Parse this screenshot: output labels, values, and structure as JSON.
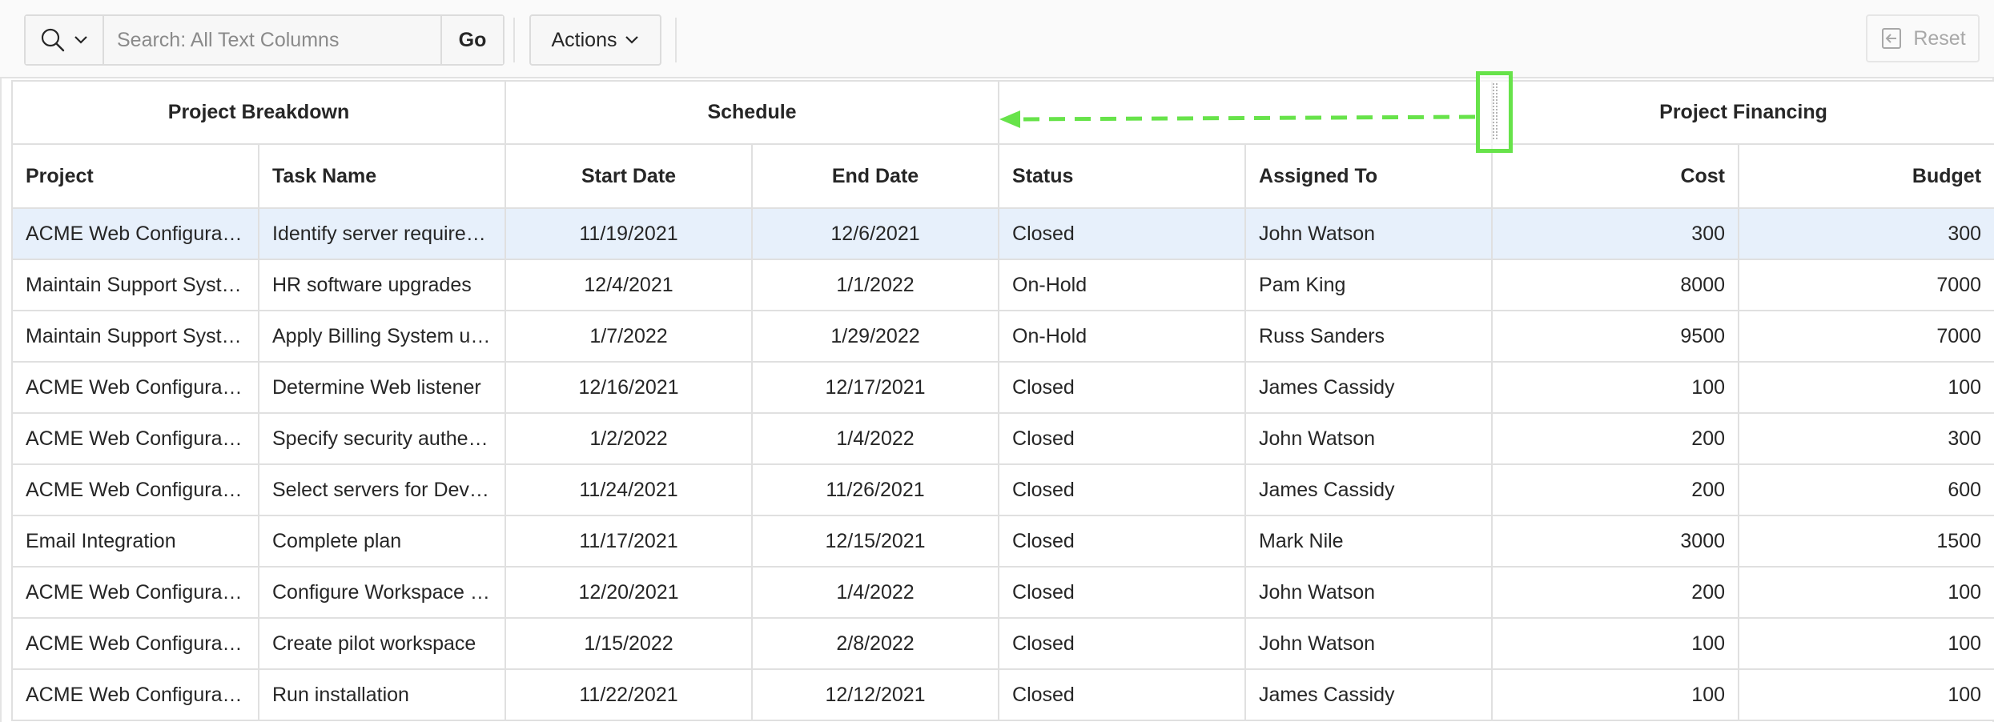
{
  "toolbar": {
    "search_placeholder": "Search: All Text Columns",
    "go_label": "Go",
    "actions_label": "Actions",
    "reset_label": "Reset"
  },
  "icons": {
    "search": "search-icon",
    "chevron": "chevron-down-icon",
    "reset": "reset-icon"
  },
  "colors": {
    "selected_row": "#e7f0fb",
    "drag_highlight": "#67e34a"
  },
  "groups": [
    {
      "label": "Project Breakdown"
    },
    {
      "label": "Schedule"
    },
    {
      "label": ""
    },
    {
      "label": "Project Financing"
    }
  ],
  "columns": [
    "Project",
    "Task Name",
    "Start Date",
    "End Date",
    "Status",
    "Assigned To",
    "Cost",
    "Budget"
  ],
  "rows": [
    [
      "ACME Web Configuration",
      "Identify server requirements",
      "11/19/2021",
      "12/6/2021",
      "Closed",
      "John Watson",
      "300",
      "300"
    ],
    [
      "Maintain Support Systems",
      "HR software upgrades",
      "12/4/2021",
      "1/1/2022",
      "On-Hold",
      "Pam King",
      "8000",
      "7000"
    ],
    [
      "Maintain Support Systems",
      "Apply Billing System updates",
      "1/7/2022",
      "1/29/2022",
      "On-Hold",
      "Russ Sanders",
      "9500",
      "7000"
    ],
    [
      "ACME Web Configuration",
      "Determine Web listener",
      "12/16/2021",
      "12/17/2021",
      "Closed",
      "James Cassidy",
      "100",
      "100"
    ],
    [
      "ACME Web Configuration",
      "Specify security authentication",
      "1/2/2022",
      "1/4/2022",
      "Closed",
      "John Watson",
      "200",
      "300"
    ],
    [
      "ACME Web Configuration",
      "Select servers for Development",
      "11/24/2021",
      "11/26/2021",
      "Closed",
      "James Cassidy",
      "200",
      "600"
    ],
    [
      "Email Integration",
      "Complete plan",
      "11/17/2021",
      "12/15/2021",
      "Closed",
      "Mark Nile",
      "3000",
      "1500"
    ],
    [
      "ACME Web Configuration",
      "Configure Workspace provisioning",
      "12/20/2021",
      "1/4/2022",
      "Closed",
      "John Watson",
      "200",
      "100"
    ],
    [
      "ACME Web Configuration",
      "Create pilot workspace",
      "1/15/2022",
      "2/8/2022",
      "Closed",
      "John Watson",
      "100",
      "100"
    ],
    [
      "ACME Web Configuration",
      "Run installation",
      "11/22/2021",
      "12/12/2021",
      "Closed",
      "James Cassidy",
      "100",
      "100"
    ]
  ]
}
